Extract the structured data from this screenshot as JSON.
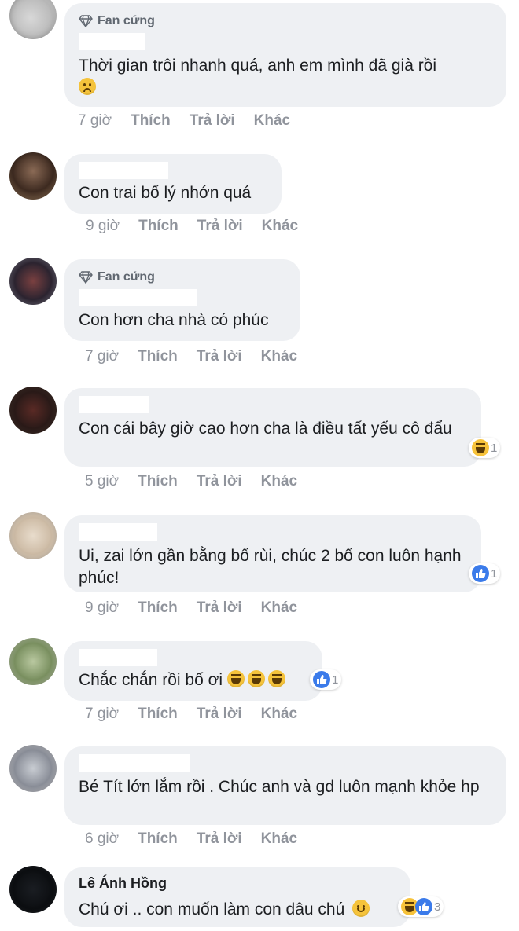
{
  "comments": [
    {
      "badge": "Fan cứng",
      "text": "Thời gian trôi nhanh quá, anh em mình đã già rồi",
      "time": "7 giờ",
      "like": "Thích",
      "reply": "Trả lời",
      "more": "Khác"
    },
    {
      "text": "Con trai bố lý nhớn quá",
      "time": "9 giờ",
      "like": "Thích",
      "reply": "Trả lời",
      "more": "Khác"
    },
    {
      "badge": "Fan cứng",
      "text": "Con hơn cha nhà có phúc",
      "time": "7 giờ",
      "like": "Thích",
      "reply": "Trả lời",
      "more": "Khác"
    },
    {
      "text": "Con cái bây giờ cao hơn cha là điều tất yếu cô đẩu",
      "time": "5 giờ",
      "like": "Thích",
      "reply": "Trả lời",
      "more": "Khác",
      "reaction_count": "1"
    },
    {
      "text": "Ui, zai lớn gần bằng bố rùi, chúc 2 bố con luôn hạnh phúc!",
      "time": "9 giờ",
      "like": "Thích",
      "reply": "Trả lời",
      "more": "Khác",
      "reaction_count": "1"
    },
    {
      "text": "Chắc chắn rồi bố ơi",
      "time": "7 giờ",
      "like": "Thích",
      "reply": "Trả lời",
      "more": "Khác",
      "reaction_count": "1"
    },
    {
      "text": "Bé Tít lớn lắm rồi . Chúc anh và gd luôn mạnh khỏe hp",
      "time": "6 giờ",
      "like": "Thích",
      "reply": "Trả lời",
      "more": "Khác"
    },
    {
      "name": "Lê Ánh Hồng",
      "text": "Chú ơi .. con muốn làm con dâu chú",
      "reaction_count": "3"
    }
  ],
  "colors": {
    "bubble": "#eef0f3",
    "meta": "#90949c",
    "like_blue": "#3b7bea",
    "haha_yellow": "#f7c33b"
  },
  "icons": [
    "diamond-icon",
    "sad-emoji-icon",
    "haha-reaction-icon",
    "like-reaction-icon",
    "smile-emoji-icon"
  ]
}
